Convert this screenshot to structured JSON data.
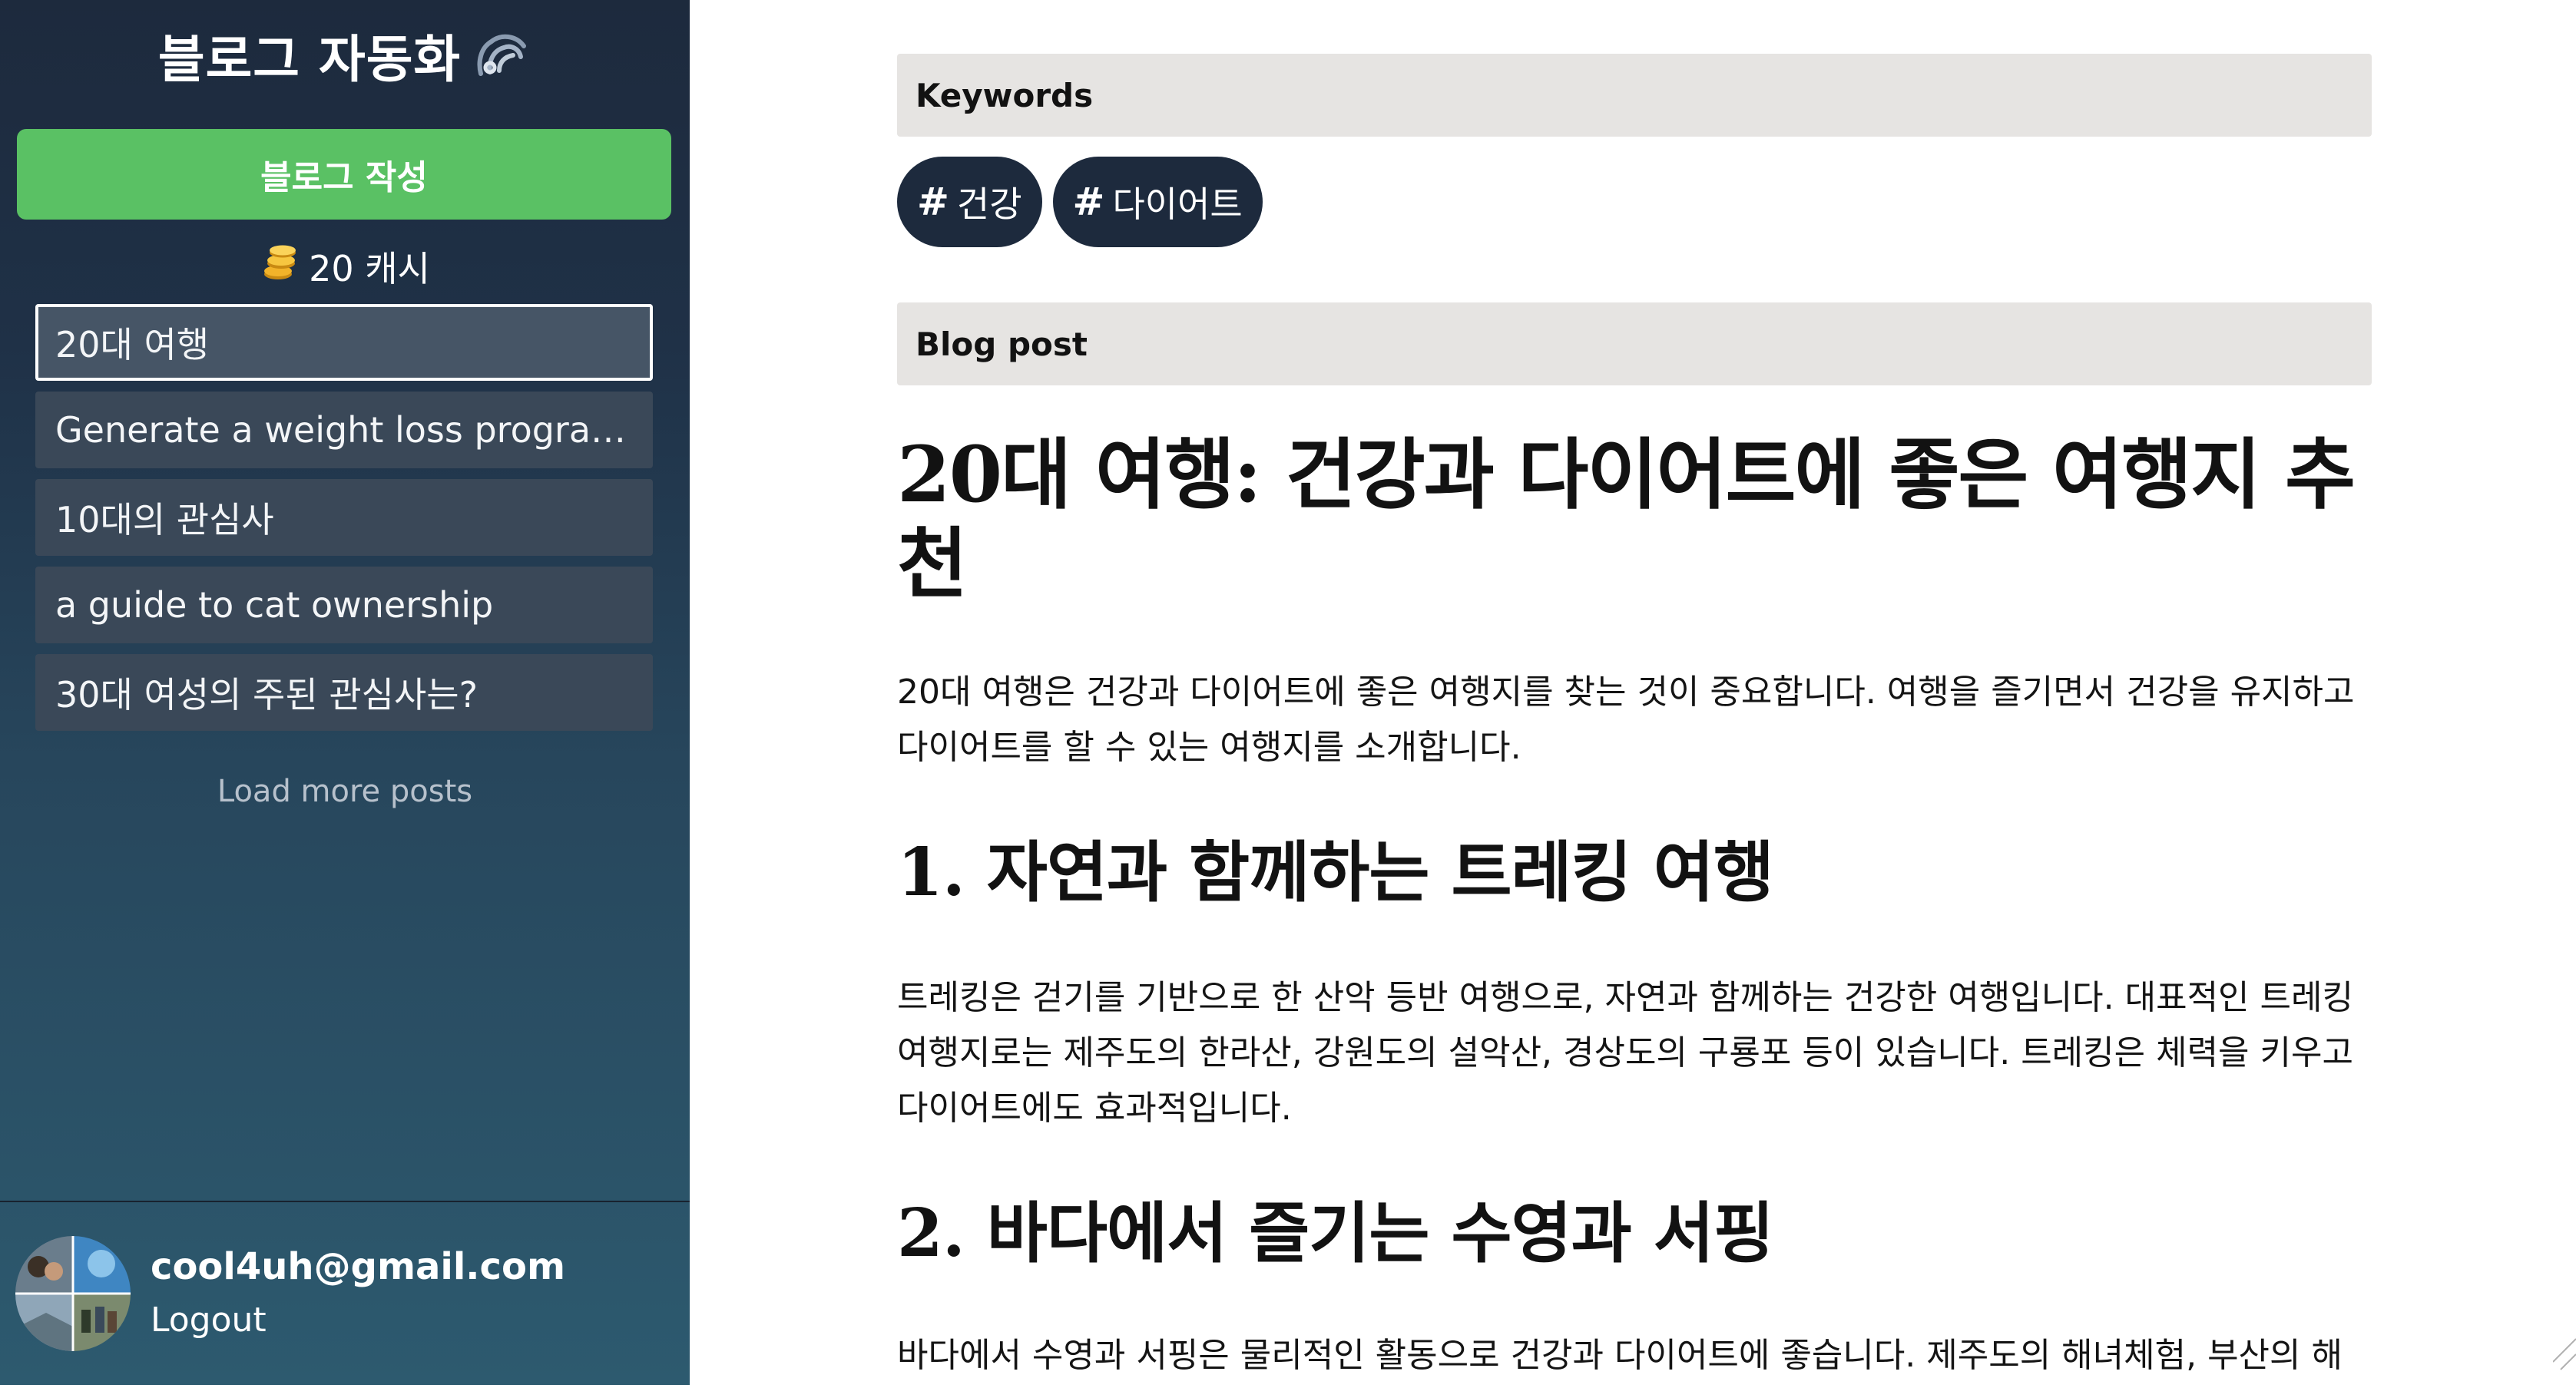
{
  "sidebar": {
    "brand_title": "블로그 자동화",
    "brand_icon": "swirl-logo-icon",
    "write_button": "블로그 작성",
    "cash_icon": "coin-stack-icon",
    "cash_label": "20 캐시",
    "posts": [
      {
        "label": "20대 여행",
        "active": true
      },
      {
        "label": "Generate a weight loss program ...",
        "active": false
      },
      {
        "label": "10대의 관심사",
        "active": false
      },
      {
        "label": "a guide to cat ownership",
        "active": false
      },
      {
        "label": "30대 여성의 주된 관심사는?",
        "active": false
      }
    ],
    "load_more": "Load more posts",
    "user": {
      "email": "cool4uh@gmail.com",
      "logout": "Logout"
    }
  },
  "main": {
    "keywords_heading": "Keywords",
    "keywords": [
      {
        "hash": "#",
        "label": "건강"
      },
      {
        "hash": "#",
        "label": "다이어트"
      }
    ],
    "blog_heading": "Blog post",
    "article": {
      "title": "20대 여행: 건강과 다이어트에 좋은 여행지 추천",
      "intro": "20대 여행은 건강과 다이어트에 좋은 여행지를 찾는 것이 중요합니다. 여행을 즐기면서 건강을 유지하고 다이어트를 할 수 있는 여행지를 소개합니다.",
      "section1_title": "1. 자연과 함께하는 트레킹 여행",
      "section1_body": "트레킹은 걷기를 기반으로 한 산악 등반 여행으로, 자연과 함께하는 건강한 여행입니다. 대표적인 트레킹 여행지로는 제주도의 한라산, 강원도의 설악산, 경상도의 구룡포 등이 있습니다. 트레킹은 체력을 키우고 다이어트에도 효과적입니다.",
      "section2_title": "2. 바다에서 즐기는 수영과 서핑",
      "section2_body": "바다에서 수영과 서핑은 물리적인 활동으로 건강과 다이어트에 좋습니다. 제주도의 해녀체험, 부산의 해"
    }
  },
  "colors": {
    "sidebar_top": "#1d2a3d",
    "sidebar_bottom": "#2d5a6f",
    "write_button": "#5ac164",
    "chip": "#1d2a3d",
    "section_bar": "#e6e4e2"
  }
}
